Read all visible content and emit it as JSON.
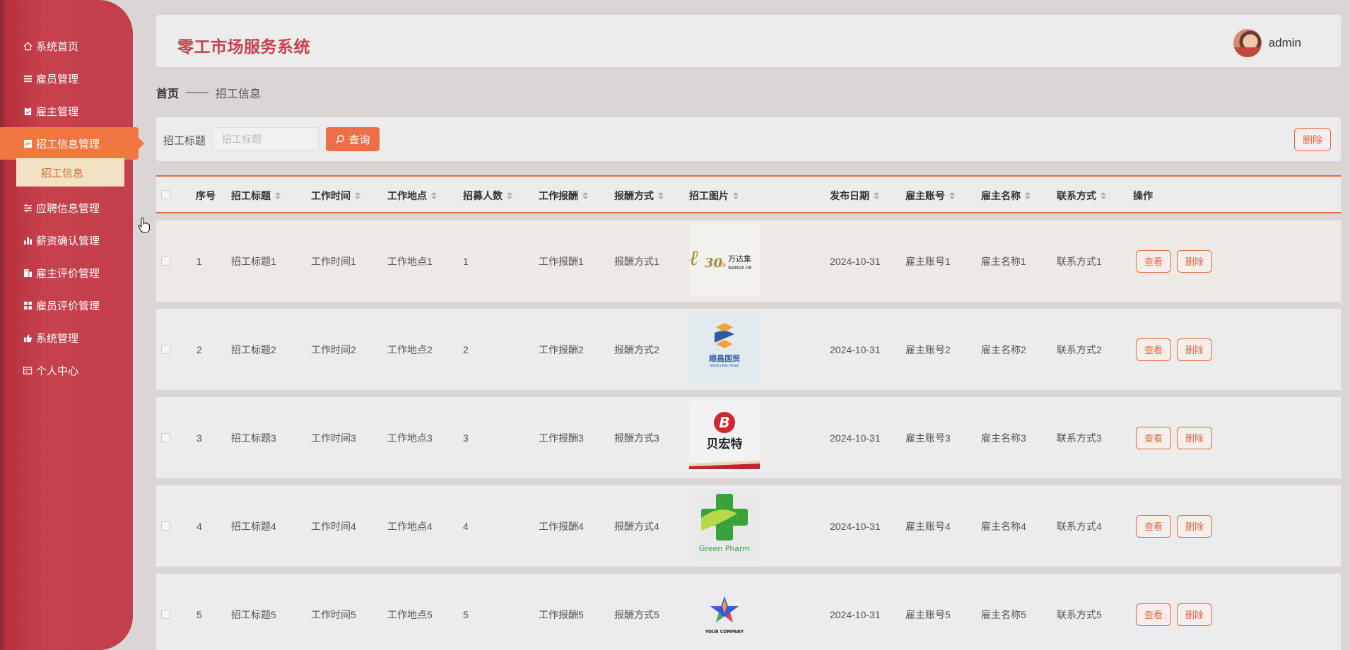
{
  "app": {
    "title": "零工市场服务系统",
    "username": "admin"
  },
  "sidebar": {
    "items": [
      {
        "label": "系统首页",
        "icon": "home-icon"
      },
      {
        "label": "雇员管理",
        "icon": "list-icon"
      },
      {
        "label": "雇主管理",
        "icon": "clipboard-icon"
      },
      {
        "label": "招工信息管理",
        "icon": "chart-icon"
      },
      {
        "label": "应聘信息管理",
        "icon": "sliders-icon"
      },
      {
        "label": "薪资确认管理",
        "icon": "bar-chart-icon"
      },
      {
        "label": "雇主评价管理",
        "icon": "building-icon"
      },
      {
        "label": "雇员评价管理",
        "icon": "grid-icon"
      },
      {
        "label": "系统管理",
        "icon": "hand-icon"
      },
      {
        "label": "个人中心",
        "icon": "card-icon"
      }
    ],
    "active_sub": "招工信息"
  },
  "breadcrumb": {
    "home": "首页",
    "sep": "——",
    "current": "招工信息"
  },
  "search": {
    "label": "招工标题",
    "placeholder": "招工标题",
    "button": "查询",
    "bulk_delete": "删除"
  },
  "table": {
    "headers": [
      "序号",
      "招工标题",
      "工作时间",
      "工作地点",
      "招募人数",
      "工作报酬",
      "报酬方式",
      "招工图片",
      "发布日期",
      "雇主账号",
      "雇主名称",
      "联系方式",
      "操作"
    ],
    "view_label": "查看",
    "delete_label": "删除",
    "rows": [
      {
        "no": "1",
        "title": "招工标题1",
        "time": "工作时间1",
        "place": "工作地点1",
        "count": "1",
        "pay": "工作报酬1",
        "pay_method": "报酬方式1",
        "image": "万达集 WANDA GR 30th",
        "date": "2024-10-31",
        "account": "雇主账号1",
        "name": "雇主名称1",
        "contact": "联系方式1"
      },
      {
        "no": "2",
        "title": "招工标题2",
        "time": "工作时间2",
        "place": "工作地点2",
        "count": "2",
        "pay": "工作报酬2",
        "pay_method": "报酬方式2",
        "image": "顺昌国贸 SHUNCHANG TRADE",
        "date": "2024-10-31",
        "account": "雇主账号2",
        "name": "雇主名称2",
        "contact": "联系方式2"
      },
      {
        "no": "3",
        "title": "招工标题3",
        "time": "工作时间3",
        "place": "工作地点3",
        "count": "3",
        "pay": "工作报酬3",
        "pay_method": "报酬方式3",
        "image": "贝宏特",
        "date": "2024-10-31",
        "account": "雇主账号3",
        "name": "雇主名称3",
        "contact": "联系方式3"
      },
      {
        "no": "4",
        "title": "招工标题4",
        "time": "工作时间4",
        "place": "工作地点4",
        "count": "4",
        "pay": "工作报酬4",
        "pay_method": "报酬方式4",
        "image": "Green Pharm",
        "date": "2024-10-31",
        "account": "雇主账号4",
        "name": "雇主名称4",
        "contact": "联系方式4"
      },
      {
        "no": "5",
        "title": "招工标题5",
        "time": "工作时间5",
        "place": "工作地点5",
        "count": "5",
        "pay": "工作报酬5",
        "pay_method": "报酬方式5",
        "image": "YOUR COMPANY",
        "date": "2024-10-31",
        "account": "雇主账号5",
        "name": "雇主名称5",
        "contact": "联系方式5"
      }
    ]
  },
  "colors": {
    "accent": "#e0683c",
    "brand": "#c8404d",
    "sidebar": "#c43f4c"
  }
}
